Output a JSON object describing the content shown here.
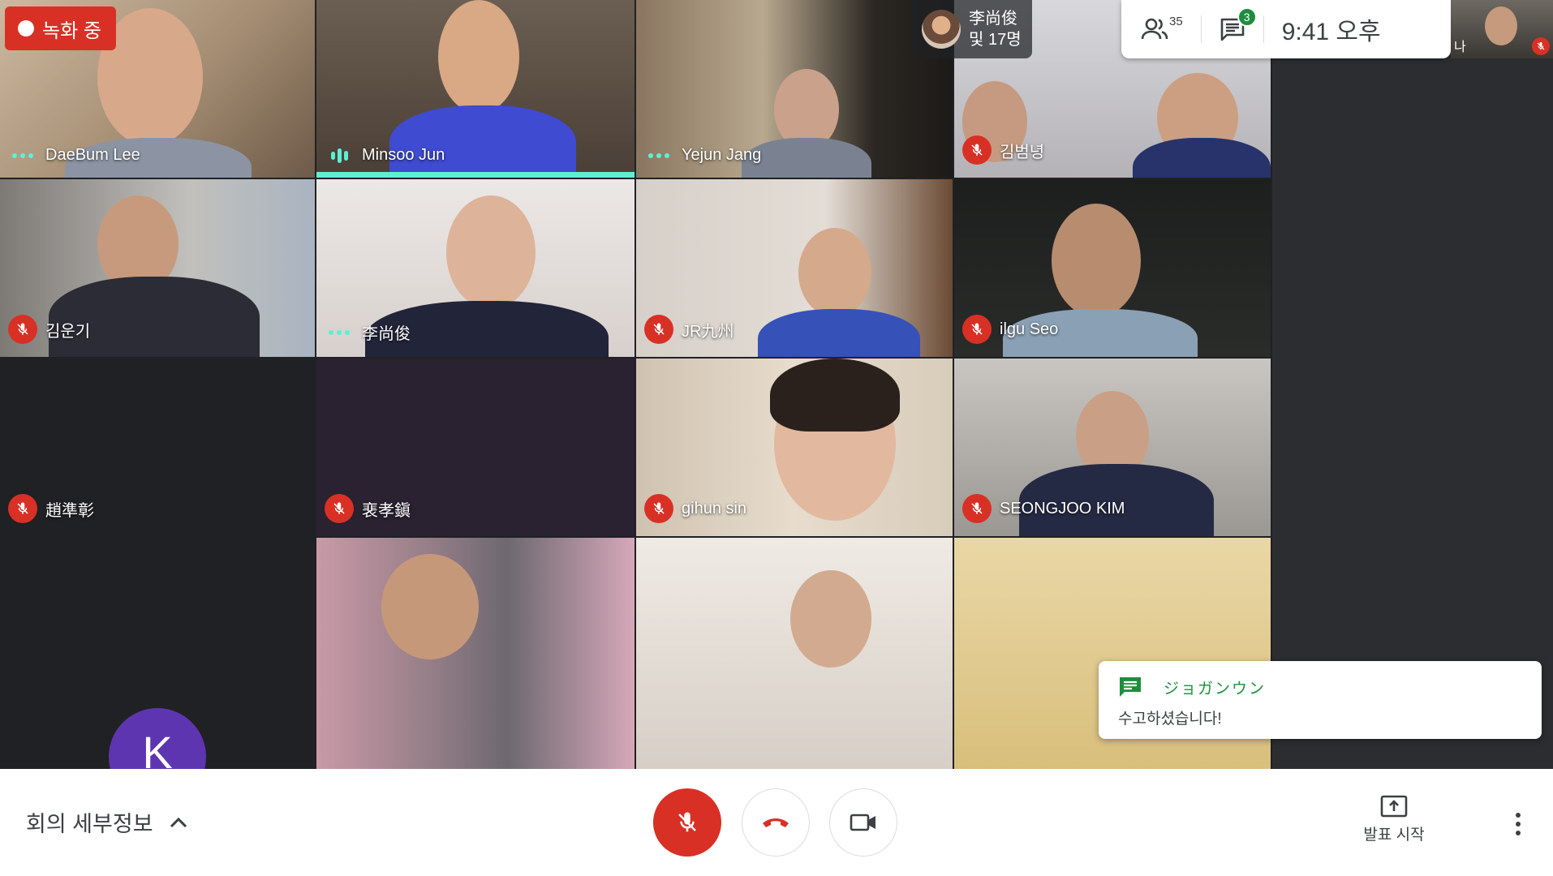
{
  "recording": {
    "label": "녹화 중"
  },
  "presenter": {
    "name": "李尚俊",
    "others": "및 17명"
  },
  "header": {
    "participant_count": "35",
    "chat_unread": "3",
    "time": "9:41 오후"
  },
  "self_view": {
    "label": "나"
  },
  "participants": [
    {
      "name": "DaeBum Lee",
      "status": "speaking-dots"
    },
    {
      "name": "Minsoo Jun",
      "status": "speaking-bars"
    },
    {
      "name": "Yejun Jang",
      "status": "speaking-dots"
    },
    {
      "name": "김범녕",
      "status": "muted"
    },
    {
      "name": "김운기",
      "status": "muted"
    },
    {
      "name": "李尚俊",
      "status": "speaking-dots"
    },
    {
      "name": "JR九州",
      "status": "muted"
    },
    {
      "name": "ilgu Seo",
      "status": "muted"
    },
    {
      "name": "趙準彰",
      "status": "muted"
    },
    {
      "name": "裵孝鎭",
      "status": "muted"
    },
    {
      "name": "gihun sin",
      "status": "muted"
    },
    {
      "name": "SEONGJOO KIM",
      "status": "muted"
    }
  ],
  "avatar_initial": "K",
  "chat_toast": {
    "sender": "ジョガンウン",
    "message": "수고하셨습니다!"
  },
  "bottom_bar": {
    "meeting_details": "회의 세부정보",
    "present_label": "발표 시작"
  },
  "colors": {
    "accent_teal": "#5df0d3",
    "danger_red": "#d93025",
    "chat_green": "#1e8e3e"
  }
}
